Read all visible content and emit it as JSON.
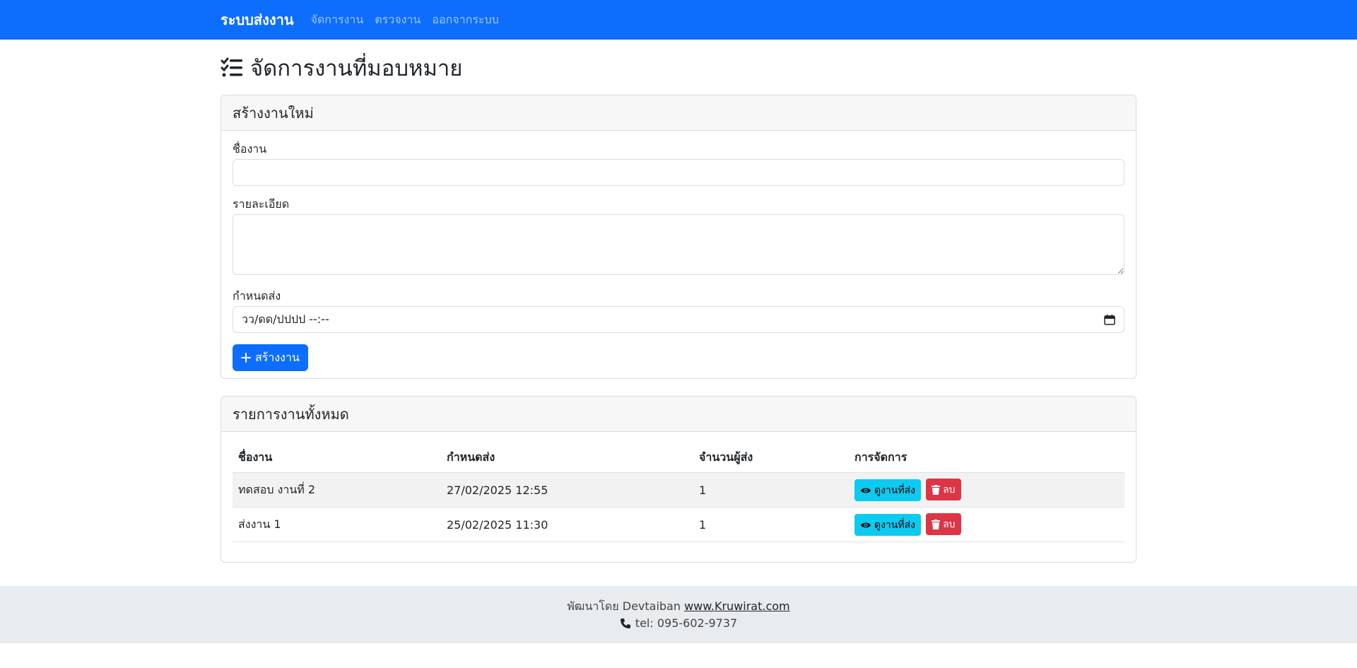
{
  "navbar": {
    "brand": "ระบบส่งงาน",
    "links": [
      "จัดการงาน",
      "ตรวจงาน",
      "ออกจากระบบ"
    ]
  },
  "page": {
    "title": "จัดการงานที่มอบหมาย",
    "title_icon": "list-check-icon"
  },
  "create_card": {
    "header": "สร้างงานใหม่",
    "fields": {
      "name_label": "ชื่องาน",
      "name_value": "",
      "detail_label": "รายละเอียด",
      "detail_value": "",
      "due_label": "กำหนดส่ง",
      "due_placeholder": "วว/ดด/ปปปป --:--"
    },
    "submit_label": "สร้างงาน"
  },
  "list_card": {
    "header": "รายการงานทั้งหมด",
    "columns": [
      "ชื่องาน",
      "กำหนดส่ง",
      "จำนวนผู้ส่ง",
      "การจัดการ"
    ],
    "rows": [
      {
        "name": "ทดสอบ งานที่ 2",
        "due": "27/02/2025 12:55",
        "count": "1",
        "view_label": "ดูงานที่ส่ง",
        "delete_label": "ลบ"
      },
      {
        "name": "ส่งงาน 1",
        "due": "25/02/2025 11:30",
        "count": "1",
        "view_label": "ดูงานที่ส่ง",
        "delete_label": "ลบ"
      }
    ]
  },
  "footer": {
    "credit_prefix": "พัฒนาโดย Devtaiban",
    "site_link": "www.Kruwirat.com",
    "phone": "tel: 095-602-9737"
  },
  "colors": {
    "primary": "#0d6efd",
    "info": "#0dcaf0",
    "danger": "#dc3545",
    "footer_bg": "#e9ecef"
  }
}
